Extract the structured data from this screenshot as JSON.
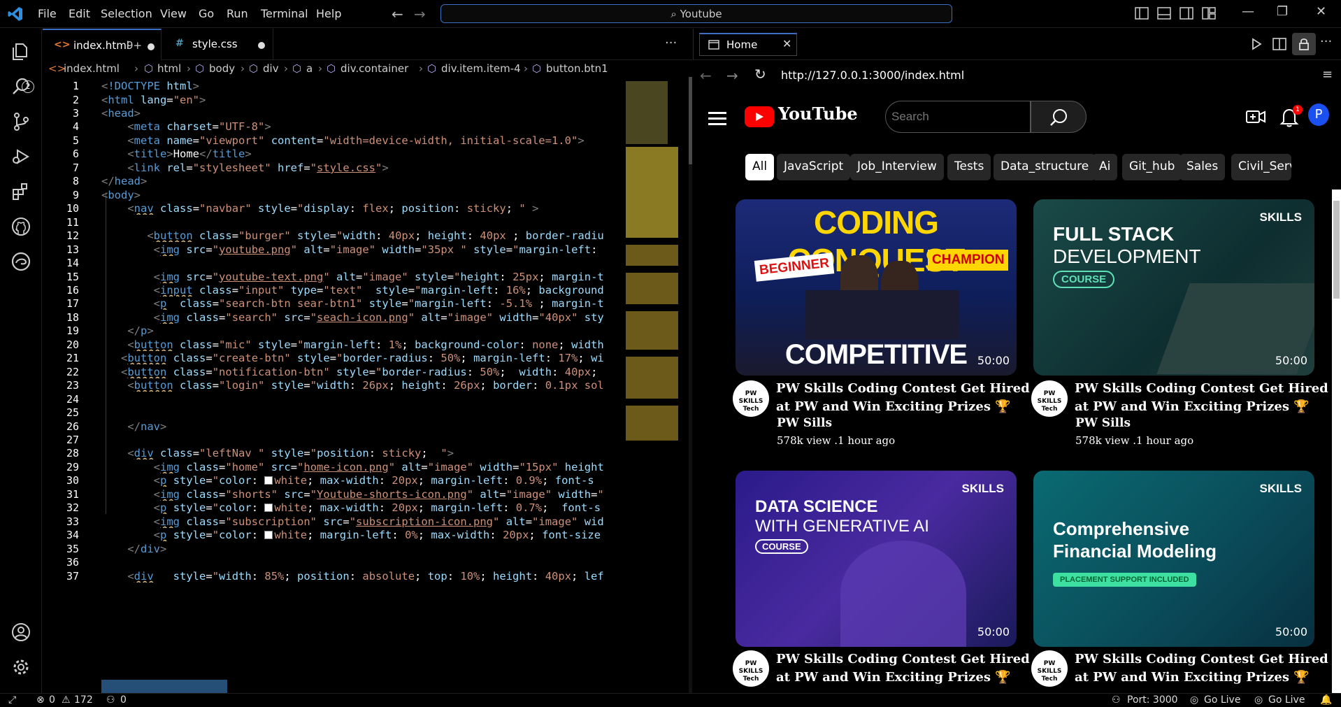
{
  "titlebar": {
    "menus": [
      "File",
      "Edit",
      "Selection",
      "View",
      "Go",
      "Run",
      "Terminal",
      "Help"
    ],
    "search_text": "Youtube"
  },
  "activitybar": {
    "explorer_badge": "2"
  },
  "tabs": [
    {
      "icon": "<>",
      "label": "index.html",
      "suffix": "9+"
    },
    {
      "icon": "#",
      "label": "style.css",
      "suffix": ""
    }
  ],
  "breadcrumb": [
    "index.html",
    "html",
    "body",
    "div",
    "a",
    "div.container",
    "div.item.item-4",
    "button.btn1"
  ],
  "code_lines": [
    "1",
    "2",
    "3",
    "4",
    "5",
    "6",
    "7",
    "8",
    "9",
    "10",
    "11",
    "12",
    "13",
    "14",
    "15",
    "16",
    "17",
    "18",
    "19",
    "20",
    "21",
    "22",
    "23",
    "24",
    "25",
    "26",
    "27",
    "28",
    "29",
    "30",
    "31",
    "32",
    "33",
    "34",
    "35",
    "36",
    "37"
  ],
  "preview": {
    "tab_label": "Home",
    "url": "http://127.0.0.1:3000/index.html"
  },
  "youtube": {
    "logo_text": "YouTube",
    "search_placeholder": "Search",
    "notification_count": "1",
    "avatar_letter": "P",
    "chips": [
      "All",
      "JavaScript",
      "Job_Interview",
      "Tests",
      "Data_structure",
      "Ai",
      "Git_hub",
      "Sales",
      "Civil_Servi"
    ],
    "cards": [
      {
        "thumb_top": "CODING CONQUEST",
        "thumb_left": "BEGINNER",
        "thumb_right": "CHAMPION",
        "thumb_bottom": "COMPETITIVE CODING",
        "duration": "50:00",
        "avatar_text": "PW SKILLS Tech",
        "title": "PW Skills Coding Contest Get Hired at PW and Win Exciting Prizes 🏆",
        "channel": "PW Sills",
        "meta": "578k view .1 hour ago"
      },
      {
        "thumb_badge": "SKILLS",
        "thumb_line1": "FULL STACK",
        "thumb_line2": "DEVELOPMENT",
        "thumb_pill": "COURSE",
        "duration": "50:00",
        "avatar_text": "PW SKILLS Tech",
        "title": "PW Skills Coding Contest Get Hired at PW and Win Exciting Prizes 🏆",
        "channel": "PW Sills",
        "meta": "578k view .1 hour ago"
      },
      {
        "thumb_badge": "SKILLS",
        "thumb_line1": "DATA SCIENCE",
        "thumb_line2": "WITH GENERATIVE AI",
        "thumb_pill": "COURSE",
        "duration": "50:00",
        "avatar_text": "PW SKILLS Tech",
        "title": "PW Skills Coding Contest Get Hired at PW and Win Exciting Prizes 🏆"
      },
      {
        "thumb_badge": "SKILLS",
        "thumb_line1": "Comprehensive",
        "thumb_line2": "Financial Modeling",
        "thumb_pill": "PLACEMENT SUPPORT INCLUDED",
        "duration": "50:00",
        "avatar_text": "PW SKILLS Tech",
        "title": "PW Skills Coding Contest Get Hired at PW and Win Exciting Prizes 🏆"
      }
    ]
  },
  "statusbar": {
    "errors": "0",
    "warnings": "172",
    "ports": "0",
    "port_label": "Port: 3000",
    "golive1": "Go Live",
    "golive2": "Go Live"
  },
  "colors": {
    "accent": "#3a6fc4",
    "youtube_red": "#ff0000"
  }
}
